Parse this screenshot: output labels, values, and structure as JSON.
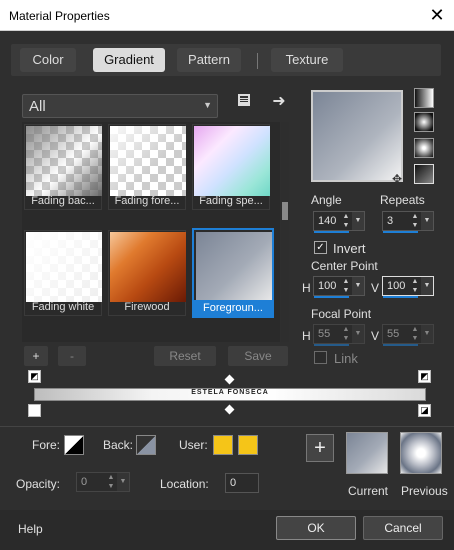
{
  "window": {
    "title": "Material Properties",
    "close_icon": "close-icon"
  },
  "tabs": [
    {
      "label": "Color"
    },
    {
      "label": "Gradient"
    },
    {
      "label": "Pattern"
    },
    {
      "label": "Texture"
    }
  ],
  "gallery": {
    "category": "All",
    "items": [
      {
        "label": "Fading bac..."
      },
      {
        "label": "Fading fore..."
      },
      {
        "label": "Fading spe..."
      },
      {
        "label": "Fading white"
      },
      {
        "label": "Firewood"
      },
      {
        "label": "Foregroun..."
      }
    ],
    "add": "+",
    "remove": "-",
    "reset": "Reset",
    "save": "Save"
  },
  "angle": {
    "label": "Angle",
    "value": "140"
  },
  "repeats": {
    "label": "Repeats",
    "value": "3"
  },
  "invert": {
    "label": "Invert",
    "checked": true
  },
  "center_point": {
    "label": "Center Point",
    "h_label": "H",
    "h": "100",
    "v_label": "V",
    "v": "100"
  },
  "focal_point": {
    "label": "Focal Point",
    "h_label": "H",
    "h": "55",
    "v_label": "V",
    "v": "55"
  },
  "link": {
    "label": "Link"
  },
  "gradient_bar_text": "ESTELA FONSECA",
  "fore": {
    "label": "Fore:"
  },
  "back": {
    "label": "Back:"
  },
  "user": {
    "label": "User:",
    "color": "#f5c518"
  },
  "opacity": {
    "label": "Opacity:",
    "value": "0"
  },
  "location": {
    "label": "Location:",
    "value": "0"
  },
  "swatches": {
    "add": "+",
    "current": "Current",
    "previous": "Previous"
  },
  "footer": {
    "help": "Help",
    "ok": "OK",
    "cancel": "Cancel"
  },
  "colors": {
    "accent": "#1e7fd6",
    "user_swatch": "#f5c518"
  }
}
